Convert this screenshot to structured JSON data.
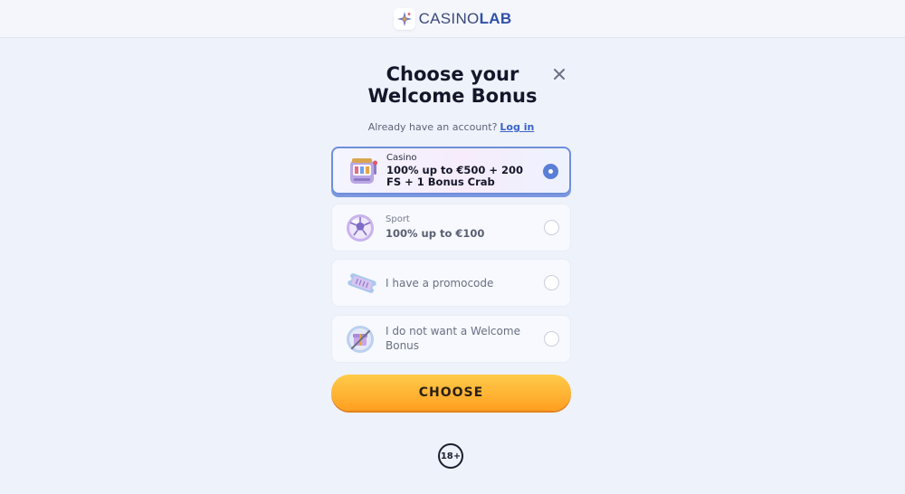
{
  "header": {
    "brand_part1": "CASINO",
    "brand_part2": "LAB"
  },
  "modal": {
    "title_line1": "Choose your",
    "title_line2": "Welcome Bonus",
    "account_prompt": "Already have an account?",
    "login_link": "Log in",
    "options": [
      {
        "label": "Casino",
        "title": "100% up to €500 + 200 FS + 1 Bonus Crab",
        "selected": true
      },
      {
        "label": "Sport",
        "title": "100% up to €100",
        "selected": false
      },
      {
        "text": "I have a promocode",
        "selected": false
      },
      {
        "text": "I do not want a Welcome Bonus",
        "selected": false
      }
    ],
    "choose_button": "CHOOSE",
    "age_badge": "18+"
  },
  "colors": {
    "accent": "#5a7fd6",
    "button": "#ffb132",
    "background": "#eef2fb"
  },
  "icons": [
    "sparkle-logo-icon",
    "close-icon",
    "slot-machine-icon",
    "soccer-ball-icon",
    "ticket-icon",
    "gift-crossed-icon"
  ]
}
